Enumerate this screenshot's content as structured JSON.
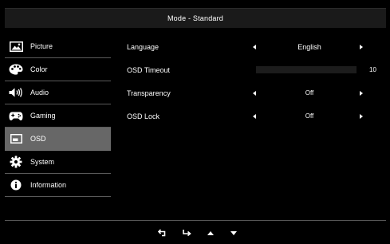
{
  "header": {
    "title": "Mode - Standard"
  },
  "sidebar": {
    "items": [
      {
        "label": "Picture",
        "icon": "picture-icon",
        "active": false
      },
      {
        "label": "Color",
        "icon": "palette-icon",
        "active": false
      },
      {
        "label": "Audio",
        "icon": "speaker-icon",
        "active": false
      },
      {
        "label": "Gaming",
        "icon": "gamepad-icon",
        "active": false
      },
      {
        "label": "OSD",
        "icon": "osd-window-icon",
        "active": true
      },
      {
        "label": "System",
        "icon": "gear-icon",
        "active": false
      },
      {
        "label": "Information",
        "icon": "info-icon",
        "active": false
      }
    ]
  },
  "settings": {
    "language": {
      "label": "Language",
      "value": "English"
    },
    "osd_timeout": {
      "label": "OSD Timeout",
      "value": "10"
    },
    "transparency": {
      "label": "Transparency",
      "value": "Off"
    },
    "osd_lock": {
      "label": "OSD  Lock",
      "value": "Off"
    }
  },
  "footer": {
    "buttons": [
      "return-icon",
      "enter-icon",
      "up-arrow-icon",
      "down-arrow-icon"
    ]
  },
  "colors": {
    "background": "#000000",
    "header": "#1a1a1a",
    "active_item": "#676767",
    "divider": "#5a5a5a"
  }
}
